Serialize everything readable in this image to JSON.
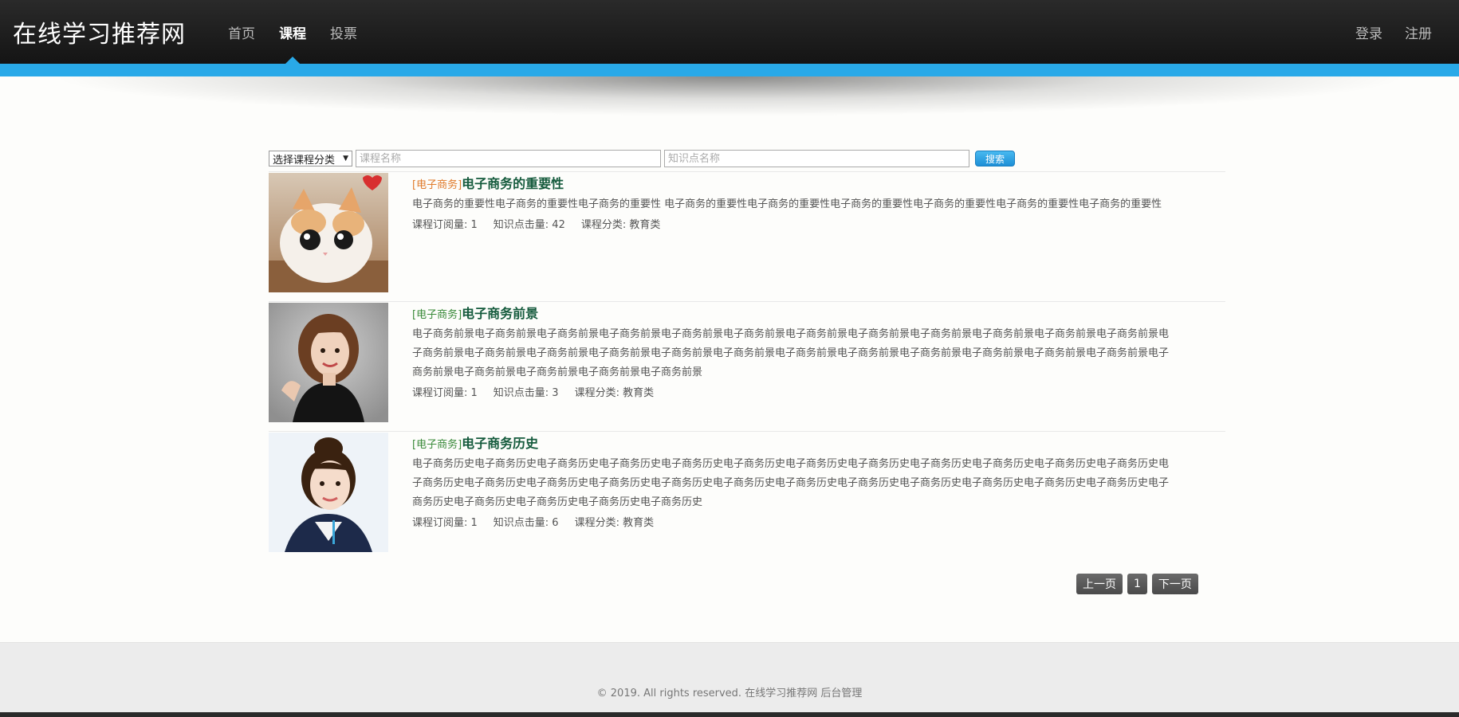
{
  "header": {
    "brand": "在线学习推荐网",
    "nav": [
      "首页",
      "课程",
      "投票"
    ],
    "active": 1,
    "login": "登录",
    "register": "注册"
  },
  "search": {
    "category_select": "选择课程分类",
    "course_placeholder": "课程名称",
    "point_placeholder": "知识点名称",
    "button": "搜索"
  },
  "courses": [
    {
      "tag": "[电子商务]",
      "title": "电子商务的重要性",
      "desc": "电子商务的重要性电子商务的重要性电子商务的重要性 电子商务的重要性电子商务的重要性电子商务的重要性电子商务的重要性电子商务的重要性电子商务的重要性",
      "subscriptions": "课程订阅量: 1",
      "clicks": "知识点击量: 42",
      "category": "课程分类: 教育类"
    },
    {
      "tag": "[电子商务]",
      "title": "电子商务前景",
      "desc": "电子商务前景电子商务前景电子商务前景电子商务前景电子商务前景电子商务前景电子商务前景电子商务前景电子商务前景电子商务前景电子商务前景电子商务前景电子商务前景电子商务前景电子商务前景电子商务前景电子商务前景电子商务前景电子商务前景电子商务前景电子商务前景电子商务前景电子商务前景电子商务前景电子商务前景电子商务前景电子商务前景电子商务前景电子商务前景",
      "subscriptions": "课程订阅量: 1",
      "clicks": "知识点击量: 3",
      "category": "课程分类: 教育类"
    },
    {
      "tag": "[电子商务]",
      "title": "电子商务历史",
      "desc": "电子商务历史电子商务历史电子商务历史电子商务历史电子商务历史电子商务历史电子商务历史电子商务历史电子商务历史电子商务历史电子商务历史电子商务历史电子商务历史电子商务历史电子商务历史电子商务历史电子商务历史电子商务历史电子商务历史电子商务历史电子商务历史电子商务历史电子商务历史电子商务历史电子商务历史电子商务历史电子商务历史电子商务历史电子商务历史",
      "subscriptions": "课程订阅量: 1",
      "clicks": "知识点击量: 6",
      "category": "课程分类: 教育类"
    }
  ],
  "pagination": {
    "prev": "上一页",
    "current": "1",
    "next": "下一页"
  },
  "footer": {
    "copyright": "© 2019. All rights reserved. 在线学习推荐网",
    "admin_link": "后台管理"
  },
  "colors": {
    "accent": "#29a9e8",
    "header_bg": "#1c1c1c",
    "tag_orange": "#e07b2c",
    "title_green": "#145a3c"
  }
}
